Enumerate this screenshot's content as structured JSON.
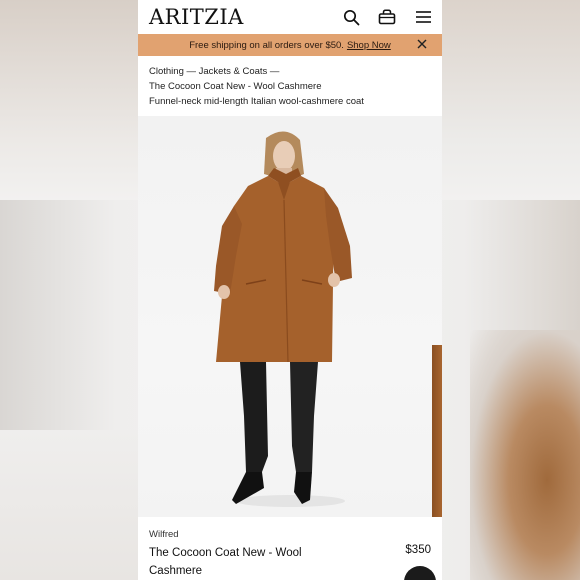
{
  "header": {
    "logo": "ARITZIA",
    "icons": [
      "search-icon",
      "bag-icon",
      "menu-icon"
    ]
  },
  "banner": {
    "text": "Free shipping on all orders over $50.",
    "link": "Shop Now",
    "color": "#e1a270"
  },
  "breadcrumb": {
    "category": "Clothing",
    "subcategory": "Jackets & Coats",
    "separator": "—",
    "product": "The Cocoon Coat New - Wool Cashmere",
    "description": "Funnel-neck mid-length Italian wool-cashmere coat"
  },
  "product": {
    "brand": "Wilfred",
    "name": "The Cocoon Coat New - Wool Cashmere",
    "price": "$350",
    "coat_color": "#a5612c"
  }
}
